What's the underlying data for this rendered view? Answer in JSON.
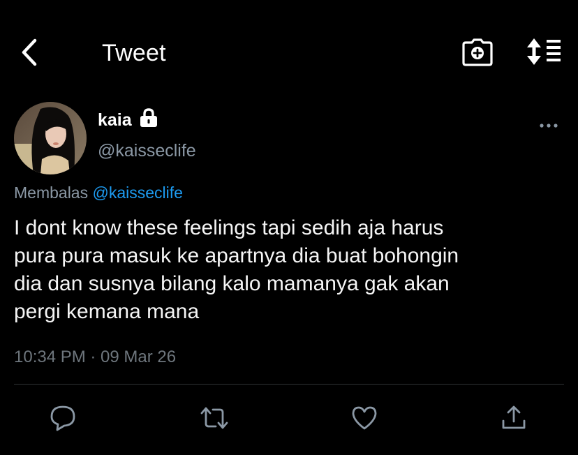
{
  "header": {
    "title": "Tweet",
    "back_icon": "chevron-left-icon",
    "camera_icon": "camera-add-icon",
    "sort_icon": "sort-list-icon"
  },
  "tweet": {
    "author": {
      "display_name": "kaia",
      "username": "@kaisseclife",
      "protected_icon": "lock-icon"
    },
    "reply_prefix": "Membalas",
    "reply_to": "@kaisseclife",
    "text": "I dont know these feelings tapi sedih aja harus\npura pura masuk ke apartnya dia buat bohongin\ndia dan susnya bilang kalo mamanya gak akan\npergi kemana mana",
    "timestamp": "10:34 PM · 09 Mar 26"
  },
  "actions": {
    "reply_icon": "comment-icon",
    "retweet_icon": "retweet-icon",
    "like_icon": "heart-icon",
    "share_icon": "share-icon"
  },
  "colors": {
    "background": "#000000",
    "link": "#1d9bf0",
    "secondary_text": "#8b98a5",
    "icon": "#8b98a5"
  }
}
